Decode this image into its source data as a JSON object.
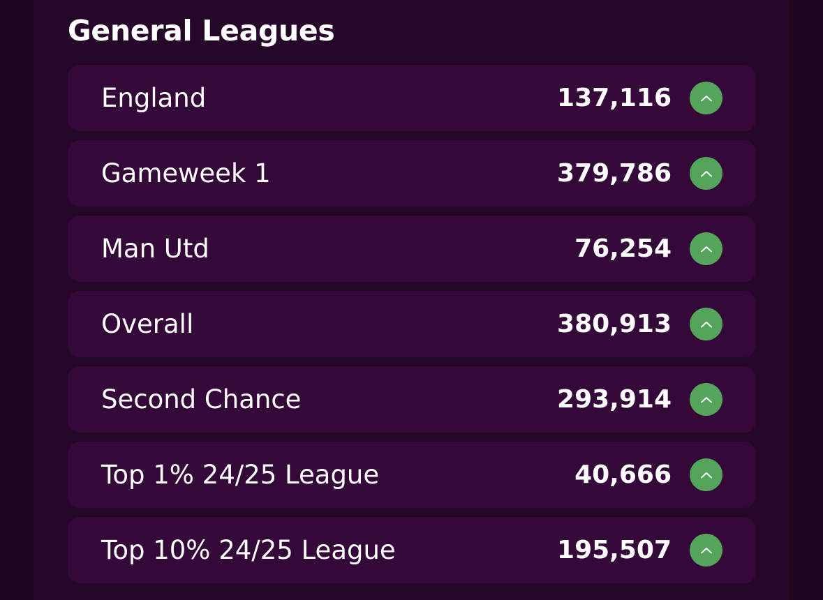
{
  "section": {
    "title": "General Leagues"
  },
  "leagues": [
    {
      "name": "England",
      "rank": "137,116",
      "movement": "up",
      "icon": "chevron-up-icon",
      "color": "#54a45a"
    },
    {
      "name": "Gameweek 1",
      "rank": "379,786",
      "movement": "up",
      "icon": "chevron-up-icon",
      "color": "#54a45a"
    },
    {
      "name": "Man Utd",
      "rank": "76,254",
      "movement": "up",
      "icon": "chevron-up-icon",
      "color": "#54a45a"
    },
    {
      "name": "Overall",
      "rank": "380,913",
      "movement": "up",
      "icon": "chevron-up-icon",
      "color": "#54a45a"
    },
    {
      "name": "Second Chance",
      "rank": "293,914",
      "movement": "up",
      "icon": "chevron-up-icon",
      "color": "#54a45a"
    },
    {
      "name": "Top 1% 24/25 League",
      "rank": "40,666",
      "movement": "up",
      "icon": "chevron-up-icon",
      "color": "#54a45a"
    },
    {
      "name": "Top 10% 24/25 League",
      "rank": "195,507",
      "movement": "up",
      "icon": "chevron-up-icon",
      "color": "#54a45a"
    }
  ]
}
